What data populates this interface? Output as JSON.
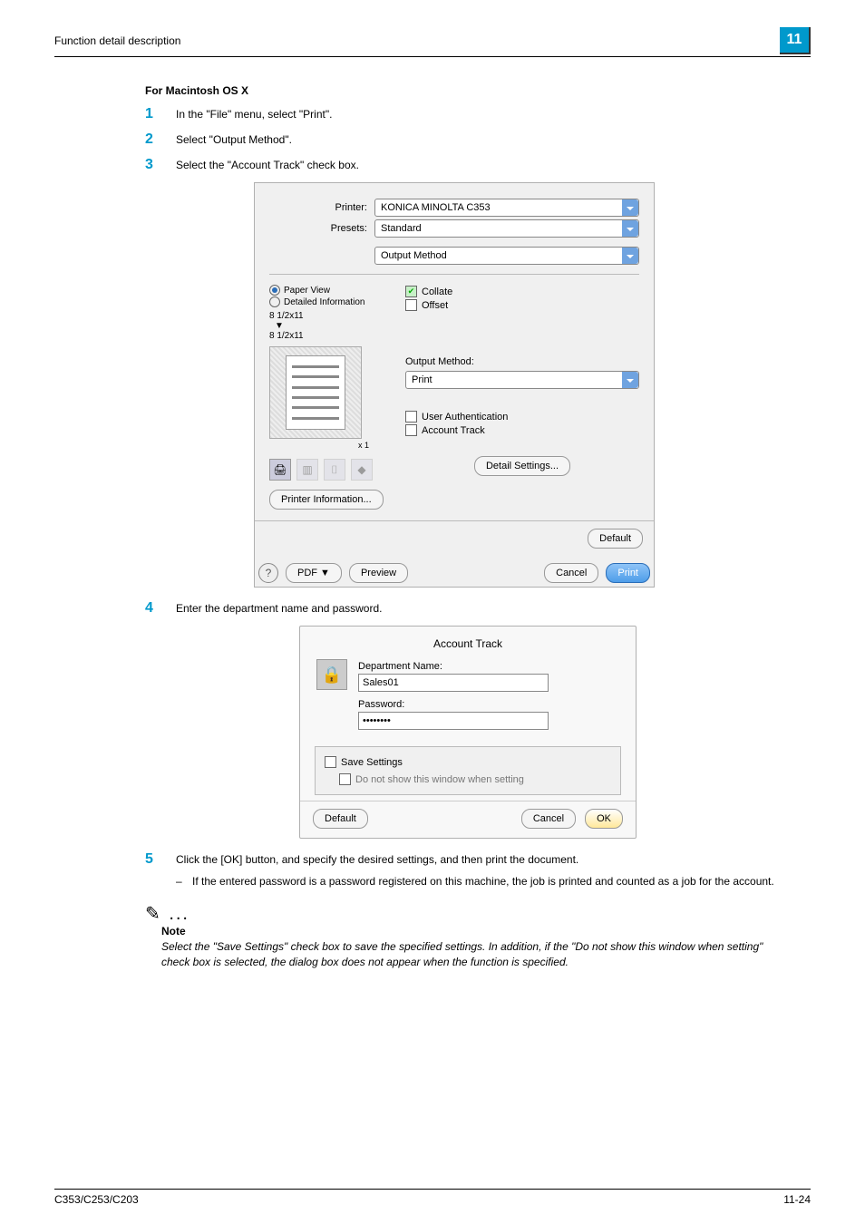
{
  "header": {
    "section": "Function detail description",
    "chapter": "11"
  },
  "title": "For Macintosh OS X",
  "steps": {
    "s1": "In the \"File\" menu, select \"Print\".",
    "s2": "Select \"Output Method\".",
    "s3": "Select the \"Account Track\" check box.",
    "s4": "Enter the department name and password.",
    "s5": "Click the [OK] button, and specify the desired settings, and then print the document.",
    "s5_sub": "If the entered password is a password registered on this machine, the job is printed and counted as a job for the account."
  },
  "dialog1": {
    "printer_label": "Printer:",
    "printer_value": "KONICA MINOLTA C353",
    "presets_label": "Presets:",
    "presets_value": "Standard",
    "panel_value": "Output Method",
    "paper_view": "Paper View",
    "detailed_info": "Detailed Information",
    "size1": "8 1/2x11",
    "size2": "8 1/2x11",
    "x1": "x 1",
    "collate": "Collate",
    "offset": "Offset",
    "output_method_label": "Output Method:",
    "output_method_value": "Print",
    "user_auth": "User Authentication",
    "account_track": "Account Track",
    "printer_info_btn": "Printer Information...",
    "detail_settings_btn": "Detail Settings...",
    "default_btn": "Default",
    "pdf_btn": "PDF ▼",
    "preview_btn": "Preview",
    "cancel_btn": "Cancel",
    "print_btn": "Print"
  },
  "dialog2": {
    "title": "Account Track",
    "dept_label": "Department Name:",
    "dept_value": "Sales01",
    "pw_label": "Password:",
    "pw_value": "••••••••",
    "save_settings": "Save Settings",
    "do_not_show": "Do not show this window when setting",
    "default_btn": "Default",
    "cancel_btn": "Cancel",
    "ok_btn": "OK"
  },
  "note": {
    "dots": "✎ ...",
    "label": "Note",
    "text": "Select the \"Save Settings\" check box to save the specified settings. In addition, if the \"Do not show this window when setting\" check box is selected, the dialog box does not appear when the function is specified."
  },
  "footer": {
    "left": "C353/C253/C203",
    "right": "11-24"
  }
}
